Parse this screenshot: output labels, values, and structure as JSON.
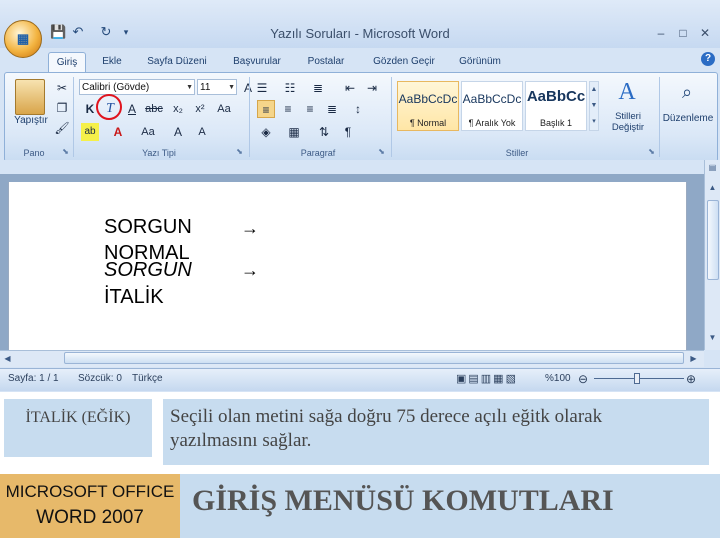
{
  "window": {
    "title": "Yazılı Soruları - Microsoft Word",
    "controls": [
      "–",
      "□",
      "✕"
    ]
  },
  "quick_access": [
    "save-icon",
    "undo-icon",
    "redo-icon"
  ],
  "tabs": [
    "Giriş",
    "Ekle",
    "Sayfa Düzeni",
    "Başvurular",
    "Postalar",
    "Gözden Geçir",
    "Görünüm"
  ],
  "ribbon": {
    "clipboard": {
      "paste_label": "Yapıştır",
      "group_label": "Pano"
    },
    "font": {
      "font_name": "Calibri (Gövde)",
      "font_size": "11",
      "bold": "K",
      "italic": "T",
      "underline": "A",
      "group_label": "Yazı Tipi",
      "highlighted_button": "italic"
    },
    "paragraph": {
      "group_label": "Paragraf"
    },
    "styles": {
      "items": [
        {
          "preview": "AaBbCcDc",
          "name": "¶ Normal"
        },
        {
          "preview": "AaBbCcDc",
          "name": "¶ Aralık Yok"
        },
        {
          "preview": "AaBbCc",
          "name": "Başlık 1"
        }
      ],
      "change_styles": "Stilleri Değiştir",
      "group_label": "Stiller"
    },
    "editing": {
      "label": "Düzenleme"
    }
  },
  "document": {
    "line1": "SORGUN",
    "line2": "NORMAL",
    "line3": "SORGUN",
    "line4": "İTALİK",
    "arrow": "→"
  },
  "status_bar": {
    "page": "Sayfa: 1 / 1",
    "words": "Sözcük: 0",
    "language": "Türkçe",
    "zoom": "%100"
  },
  "slide": {
    "term": "İTALİK (EĞİK)",
    "definition": "Seçili olan metini sağa doğru 75 derece açılı eğitk olarak yazılmasını sağlar.",
    "footer_left_line1": "MICROSOFT OFFICE",
    "footer_left_line2": "WORD 2007",
    "footer_title": "GİRİŞ MENÜSÜ KOMUTLARI"
  },
  "colors": {
    "ribbon_bg": "#dbe8f7",
    "highlight_circle": "#e0141e",
    "slide_box": "#c7dcef",
    "footer_orange": "#e7b96a"
  }
}
